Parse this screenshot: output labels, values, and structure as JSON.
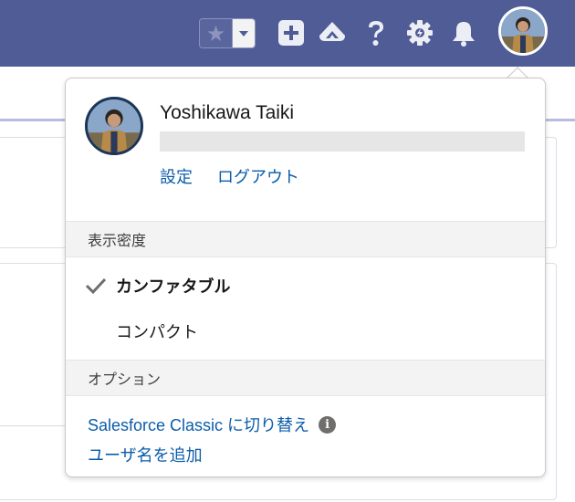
{
  "header": {
    "favorites_star": "★",
    "icons": [
      "favorites-star-icon",
      "dropdown-caret-icon",
      "add-icon",
      "trailhead-icon",
      "help-icon",
      "setup-gear-icon",
      "notification-bell-icon",
      "user-avatar"
    ]
  },
  "user_menu": {
    "name": "Yoshikawa Taiki",
    "settings_label": "設定",
    "logout_label": "ログアウト",
    "density_header": "表示密度",
    "density_options": [
      {
        "label": "カンファタブル",
        "selected": true
      },
      {
        "label": "コンパクト",
        "selected": false
      }
    ],
    "options_header": "オプション",
    "switch_classic_label": "Salesforce Classic に切り替え",
    "add_username_label": "ユーザ名を追加",
    "info_glyph": "i"
  },
  "colors": {
    "header_bg": "#505c96",
    "link": "#0b5cab",
    "section_bg": "#f3f3f3"
  }
}
